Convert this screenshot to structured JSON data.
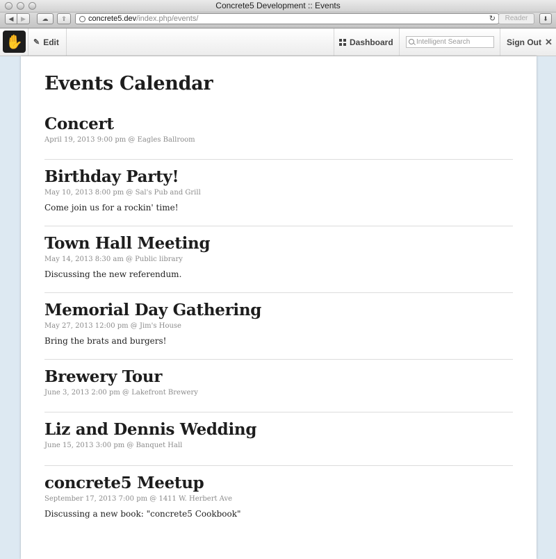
{
  "window": {
    "title": "Concrete5 Development :: Events"
  },
  "browser": {
    "url_domain": "concrete5.dev",
    "url_path": "/index.php/events/",
    "reader_label": "Reader"
  },
  "c5_toolbar": {
    "edit_label": "Edit",
    "dashboard_label": "Dashboard",
    "search_placeholder": "Intelligent Search",
    "signout_label": "Sign Out"
  },
  "page": {
    "title": "Events Calendar",
    "events": [
      {
        "title": "Concert",
        "meta": "April 19, 2013 9:00 pm @ Eagles Ballroom",
        "desc": ""
      },
      {
        "title": "Birthday Party!",
        "meta": "May 10, 2013 8:00 pm @ Sal's Pub and Grill",
        "desc": "Come join us for a rockin' time!"
      },
      {
        "title": "Town Hall Meeting",
        "meta": "May 14, 2013 8:30 am @ Public library",
        "desc": "Discussing the new referendum."
      },
      {
        "title": "Memorial Day Gathering",
        "meta": "May 27, 2013 12:00 pm @ Jim's House",
        "desc": "Bring the brats and burgers!"
      },
      {
        "title": "Brewery Tour",
        "meta": "June 3, 2013 2:00 pm @ Lakefront Brewery",
        "desc": ""
      },
      {
        "title": "Liz and Dennis Wedding",
        "meta": "June 15, 2013 3:00 pm @ Banquet Hall",
        "desc": ""
      },
      {
        "title": "concrete5 Meetup",
        "meta": "September 17, 2013 7:00 pm @ 1411 W. Herbert Ave",
        "desc": "Discussing a new book: \"concrete5 Cookbook\""
      }
    ]
  }
}
